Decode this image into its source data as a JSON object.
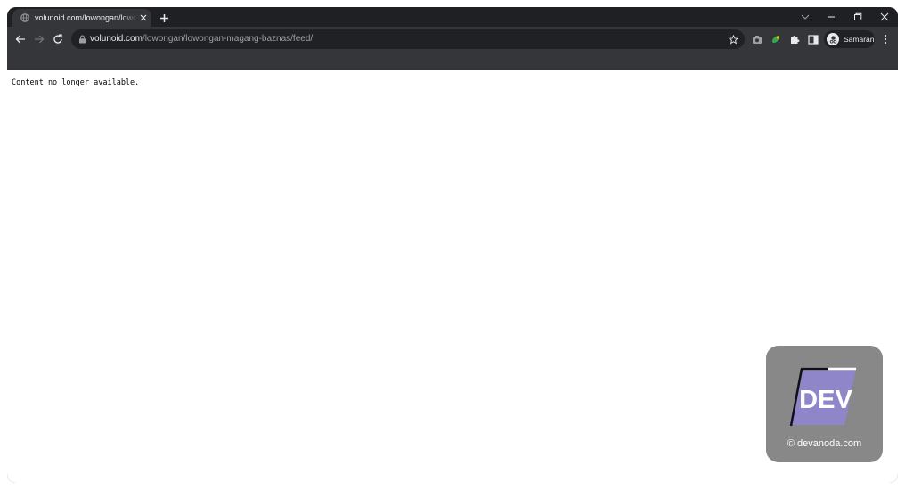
{
  "browser": {
    "tab": {
      "title": "volunoid.com/lowongan/lowongan-magang-baznas/feed/",
      "close_icon": "close-icon",
      "favicon": "globe-icon"
    },
    "new_tab_icon": "plus-icon",
    "window_controls": [
      "chevron-down-icon",
      "minimize-icon",
      "restore-icon",
      "close-icon"
    ],
    "address": {
      "host": "volunoid.com",
      "path": "/lowongan/lowongan-magang-baznas/feed/"
    },
    "profile_name": "Samaran",
    "colors": {
      "frame": "#1f2023",
      "toolbar": "#35363a",
      "omnibox": "#202124",
      "text": "#e8eaed"
    }
  },
  "page": {
    "message": "Content no longer available."
  },
  "watermark": {
    "logo_text": "DEV",
    "caption": "© devanoda.com",
    "colors": {
      "background": "#888888",
      "logo": "#8e86c8"
    }
  }
}
